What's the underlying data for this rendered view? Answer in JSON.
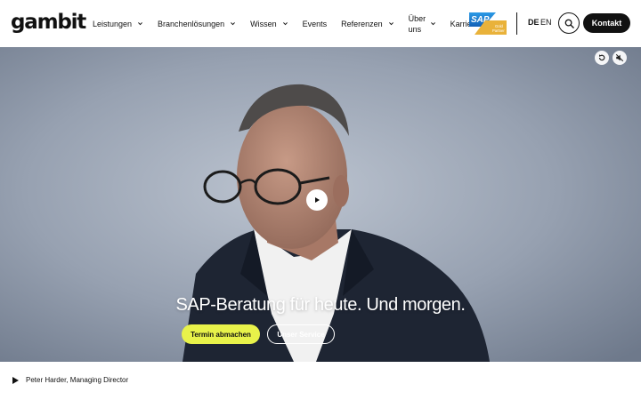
{
  "header": {
    "logo": "gambit",
    "nav": [
      {
        "label": "Leistungen",
        "has_dropdown": true
      },
      {
        "label": "Branchenlösungen",
        "has_dropdown": true
      },
      {
        "label": "Wissen",
        "has_dropdown": true
      },
      {
        "label": "Events",
        "has_dropdown": false
      },
      {
        "label": "Referenzen",
        "has_dropdown": true
      },
      {
        "label": "Über uns",
        "has_dropdown": true
      },
      {
        "label": "Karriere",
        "has_dropdown": true
      }
    ],
    "sap_badge": {
      "brand": "SAP",
      "tier": "Gold",
      "type": "Partner",
      "colors": {
        "blue": "#1b7fd1",
        "gold": "#e9b23a"
      }
    },
    "languages": [
      {
        "code": "DE",
        "active": true
      },
      {
        "code": "EN",
        "active": false
      }
    ],
    "search_icon": "search-icon",
    "contact_label": "Kontakt"
  },
  "hero": {
    "headline": "SAP-Beratung für heute. Und morgen.",
    "primary_cta": "Termin abmachen",
    "secondary_cta": "Unser Service",
    "accent": "#e8f24a",
    "controls": [
      "replay-icon",
      "mute-icon"
    ],
    "play_icon": "play-icon"
  },
  "caption": {
    "text": "Peter Harder, Managing Director",
    "icon": "play-triangle-icon"
  }
}
